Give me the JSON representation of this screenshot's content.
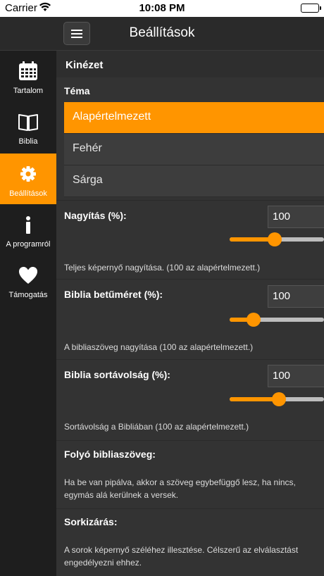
{
  "status_bar": {
    "carrier": "Carrier",
    "time": "10:08 PM",
    "battery_level": 1.0
  },
  "header": {
    "title": "Beállítások"
  },
  "sidebar": {
    "items": [
      {
        "label": "Tartalom",
        "icon": "calendar-icon",
        "active": false
      },
      {
        "label": "Biblia",
        "icon": "book-icon",
        "active": false
      },
      {
        "label": "Beállítások",
        "icon": "gear-icon",
        "active": true
      },
      {
        "label": "A programról",
        "icon": "info-icon",
        "active": false
      },
      {
        "label": "Támogatás",
        "icon": "heart-icon",
        "active": false
      }
    ]
  },
  "appearance": {
    "section_title": "Kinézet",
    "theme_label": "Téma",
    "themes": [
      "Alapértelmezett",
      "Fehér",
      "Sárga"
    ],
    "selected_theme": "Alapértelmezett"
  },
  "settings": [
    {
      "name": "Nagyítás (%):",
      "value": "100",
      "slider_fraction": 0.48,
      "description": "Teljes képernyő nagyítása. (100 az alapértelmezett.)"
    },
    {
      "name": "Biblia betűméret (%):",
      "value": "100",
      "slider_fraction": 0.25,
      "description": "A bibliaszöveg nagyítása (100 az alapértelmezett.)"
    },
    {
      "name": "Biblia sortávolság (%):",
      "value": "100",
      "slider_fraction": 0.52,
      "description": "Sortávolság a Bibliában (100 az alapértelmezett.)"
    },
    {
      "name": "Folyó bibliaszöveg:",
      "description": "Ha be van pipálva, akkor a szöveg egybefüggő lesz, ha nincs, egymás alá kerülnek a versek."
    },
    {
      "name": "Sorkizárás:",
      "description": "A sorok képernyő széléhez illesztése. Célszerű az elválasztást engedélyezni ehhez."
    }
  ],
  "colors": {
    "accent": "#ff9500",
    "sidebar_bg": "#1e1e1e",
    "content_bg": "#333333"
  }
}
